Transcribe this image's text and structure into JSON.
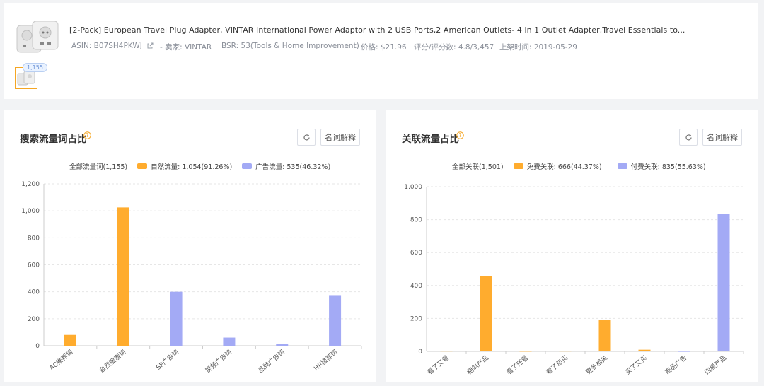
{
  "product": {
    "title": "[2-Pack] European Travel Plug Adapter, VINTAR International Power Adaptor with 2 USB Ports,2 American Outlets- 4 in 1 Outlet Adapter,Travel Essentials to...",
    "asin": "ASIN: B07SH4PKWJ",
    "seller": "- 卖家: VINTAR",
    "bsr": "BSR: 53(Tools & Home Improvement)",
    "price": "价格: $21.96",
    "rating": "评分/评分数: 4.8/3,457",
    "listed": "上架时间: 2019-05-29",
    "thumb_badge": "1,155"
  },
  "left_panel": {
    "title": "搜索流量词占比",
    "glossary_label": "名词解释",
    "legend": {
      "total": "全部流量词(1,155)",
      "organic": "自然流量: 1,054(91.26%)",
      "ad": "广告流量: 535(46.32%)"
    }
  },
  "right_panel": {
    "title": "关联流量占比",
    "glossary_label": "名词解释",
    "legend": {
      "total": "全部关联(1,501)",
      "free": "免费关联: 666(44.37%)",
      "paid": "付费关联: 835(55.63%)"
    }
  },
  "colors": {
    "orange": "#ffac2e",
    "purple": "#a3aaf5",
    "accent_help": "#f5a623"
  },
  "chart_data": [
    {
      "type": "bar",
      "categories": [
        "AC推荐词",
        "自然搜索词",
        "SP广告词",
        "视频广告词",
        "品牌广告词",
        "HR推荐词"
      ],
      "values": [
        80,
        1025,
        400,
        60,
        15,
        375
      ],
      "series_of_bar": [
        "organic",
        "organic",
        "ad",
        "ad",
        "ad",
        "ad"
      ],
      "yticks": [
        "0",
        "200",
        "400",
        "600",
        "800",
        "1,000",
        "1,200"
      ],
      "ylim": [
        0,
        1200
      ]
    },
    {
      "type": "bar",
      "categories": [
        "看了又看",
        "相似产品",
        "看了还看",
        "看了却买",
        "更多相关",
        "买了又买",
        "商品广告",
        "四星产品"
      ],
      "values": [
        2,
        455,
        1,
        2,
        190,
        10,
        0,
        835
      ],
      "series_of_bar": [
        "free",
        "free",
        "free",
        "free",
        "free",
        "free",
        "paid",
        "paid"
      ],
      "yticks": [
        "0",
        "200",
        "400",
        "600",
        "800",
        "1,000"
      ],
      "ylim": [
        0,
        1000
      ]
    }
  ]
}
